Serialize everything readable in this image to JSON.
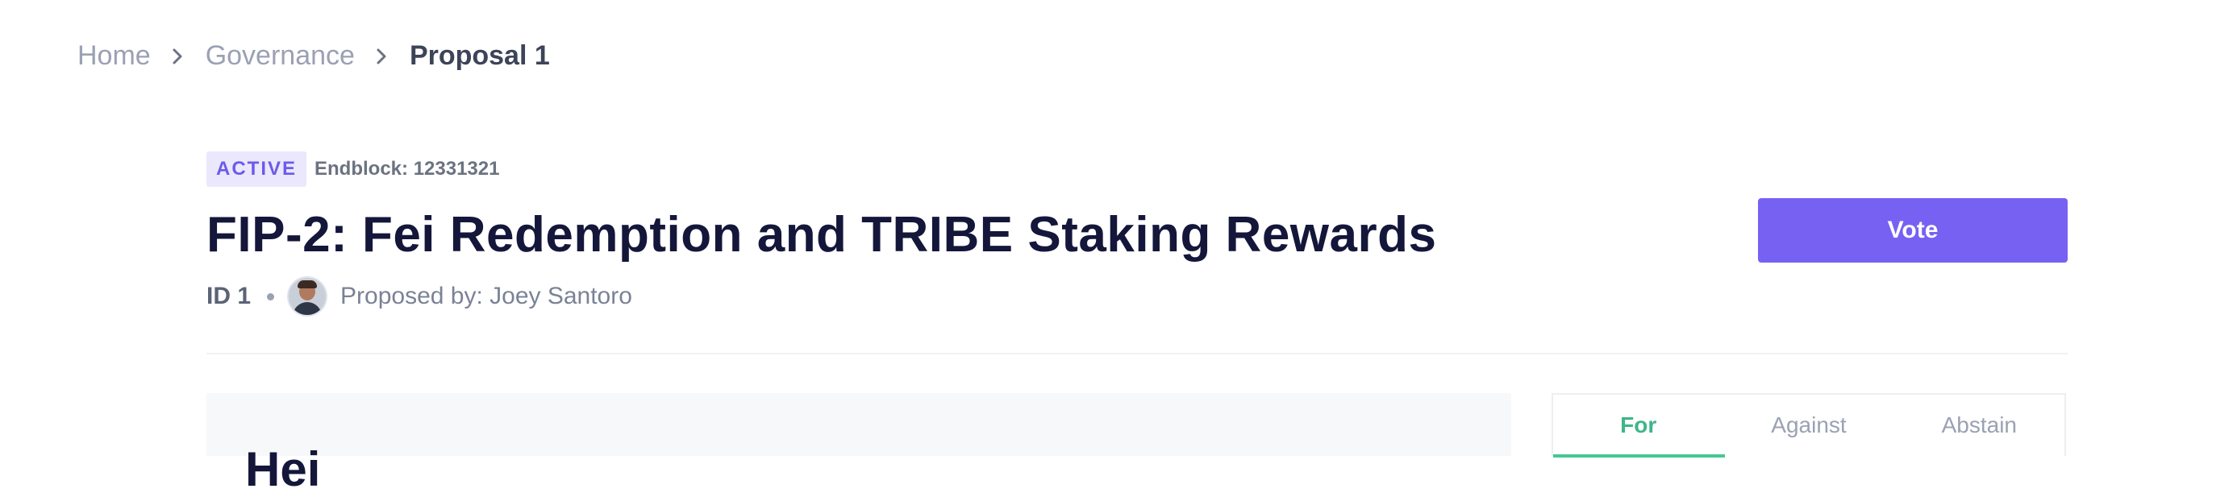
{
  "breadcrumb": {
    "items": [
      "Home",
      "Governance"
    ],
    "current": "Proposal 1"
  },
  "proposal": {
    "status": "ACTIVE",
    "endblock": "Endblock: 12331321",
    "title": "FIP-2: Fei Redemption and TRIBE Staking Rewards",
    "id_label": "ID 1",
    "proposed_by_label": "Proposed by: Joey Santoro"
  },
  "actions": {
    "vote_label": "Vote"
  },
  "content": {
    "heading": "Hei"
  },
  "vote_tabs": {
    "items": [
      "For",
      "Against",
      "Abstain"
    ],
    "active": "For"
  },
  "colors": {
    "accent": "#7761f3",
    "badge_bg": "#ebe7fd",
    "for_green": "#45c795",
    "title": "#14163a"
  },
  "icons": [
    "chevron-right-icon",
    "avatar"
  ]
}
